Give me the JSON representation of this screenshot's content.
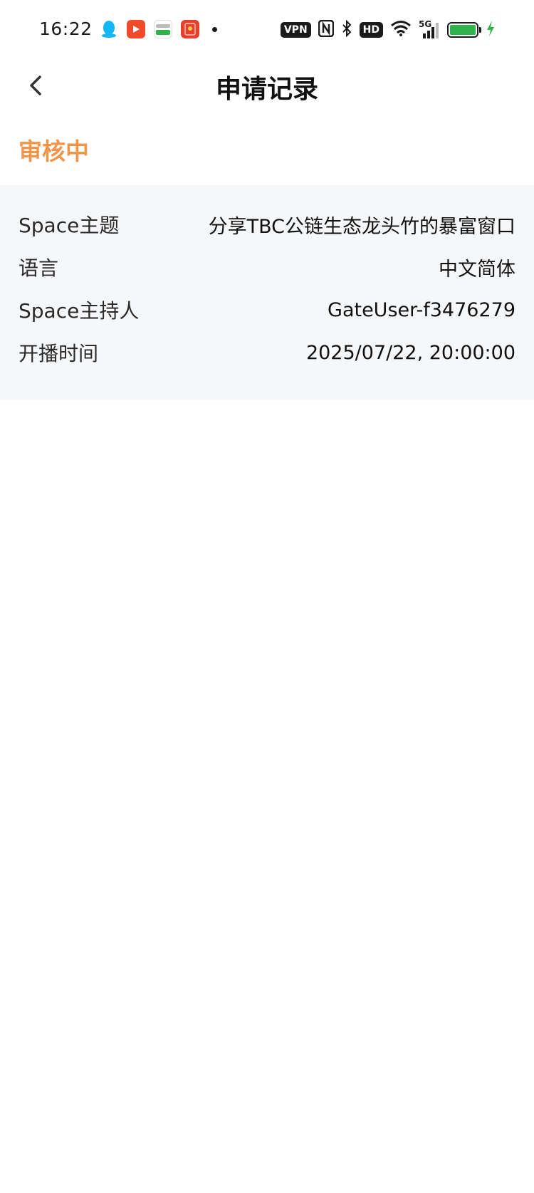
{
  "status_bar": {
    "time": "16:22",
    "vpn": "VPN",
    "hd": "HD",
    "network": "5G"
  },
  "nav": {
    "title": "申请记录"
  },
  "record": {
    "status": "审核中",
    "rows": [
      {
        "label": "Space主题",
        "value": "分享TBC公链生态龙头竹的暴富窗口"
      },
      {
        "label": "语言",
        "value": "中文简体"
      },
      {
        "label": "Space主持人",
        "value": "GateUser-f3476279"
      },
      {
        "label": "开播时间",
        "value": "2025/07/22, 20:00:00"
      }
    ]
  },
  "colors": {
    "status_pending": "#f0954a",
    "card_bg": "#f6f7f9",
    "battery_green": "#2fb34a"
  }
}
